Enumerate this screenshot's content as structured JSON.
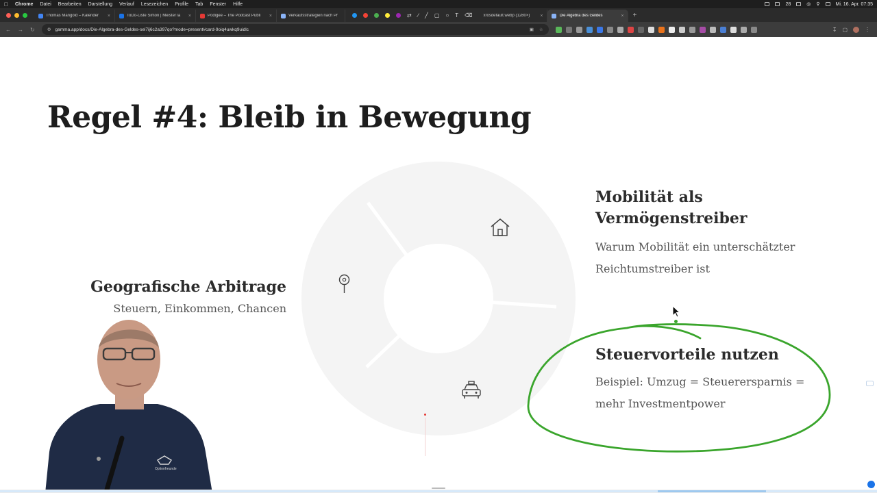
{
  "menubar": {
    "app": "Chrome",
    "items": [
      "Datei",
      "Bearbeiten",
      "Darstellung",
      "Verlauf",
      "Lesezeichen",
      "Profile",
      "Tab",
      "Fenster",
      "Hilfe"
    ],
    "clock": "Mi. 16. Apr. 07:35",
    "badge": "28"
  },
  "tabs": [
    {
      "title": "Thomas Mangold – Kalender",
      "color": "#4285f4"
    },
    {
      "title": "ToDo-Liste Simon | MeisterTa",
      "color": "#1a73e8"
    },
    {
      "title": "Podigee – The Podcast Publi",
      "color": "#e53935"
    },
    {
      "title": "Verkaufsstrategien nach Pr",
      "color": "#8ab4f8"
    },
    {
      "title": "xrosdefault.webp (1280×)",
      "color": "#9e9e9e"
    },
    {
      "title": "Die Algebra des Geldes",
      "color": "#8ab4f8",
      "active": true
    }
  ],
  "address": {
    "url": "gamma.app/docs/Die-Algebra-des-Geldes-sel7ij6c2a397qo?mode=present#card-9oiq4uwkq9uidlc"
  },
  "slide": {
    "title": "Regel #4: Bleib in Bewegung",
    "blocks": {
      "geo": {
        "heading": "Geografische Arbitrage",
        "text": "Steuern, Einkommen, Chancen"
      },
      "mob": {
        "heading": "Mobilität als Vermögenstreiber",
        "text": "Warum Mobilität ein unterschätzter Reichtumstreiber ist"
      },
      "tax": {
        "heading": "Steuervorteile nutzen",
        "text": "Beispiel: Umzug = Steuerersparnis = mehr Investmentpower"
      }
    },
    "icons": [
      "map-pin-icon",
      "home-icon",
      "taxi-icon"
    ]
  },
  "presenter": {
    "shirt_logo": "Optionfreunde"
  },
  "colors": {
    "annotation": "#3aa52c",
    "title": "#1d1d1d",
    "ring": "#f4f4f4"
  }
}
